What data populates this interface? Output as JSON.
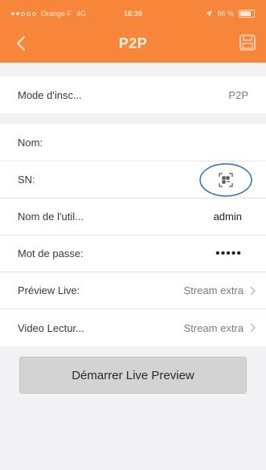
{
  "status_bar": {
    "carrier": "Orange F",
    "network": "4G",
    "time": "16:39",
    "battery": "86 %"
  },
  "nav": {
    "title": "P2P",
    "back_icon": "chevron-left-icon",
    "save_icon": "save-icon"
  },
  "form": {
    "register_mode": {
      "label": "Mode d'insc...",
      "value": "P2P"
    },
    "name": {
      "label": "Nom:",
      "value": ""
    },
    "sn": {
      "label": "SN:",
      "icon": "qr-scan-icon"
    },
    "username": {
      "label": "Nom de l'util...",
      "value": "admin"
    },
    "password": {
      "label": "Mot de passe:",
      "value": "•••••"
    },
    "preview_live": {
      "label": "Préview Live:",
      "value": "Stream extra"
    },
    "video_playback": {
      "label": "Video Lectur...",
      "value": "Stream extra"
    }
  },
  "actions": {
    "start_preview": "Démarrer Live Preview"
  },
  "colors": {
    "header": "#f7863a",
    "background": "#f2f2f4",
    "highlight_circle": "#2f6fc4",
    "button": "#d3d3d3"
  }
}
